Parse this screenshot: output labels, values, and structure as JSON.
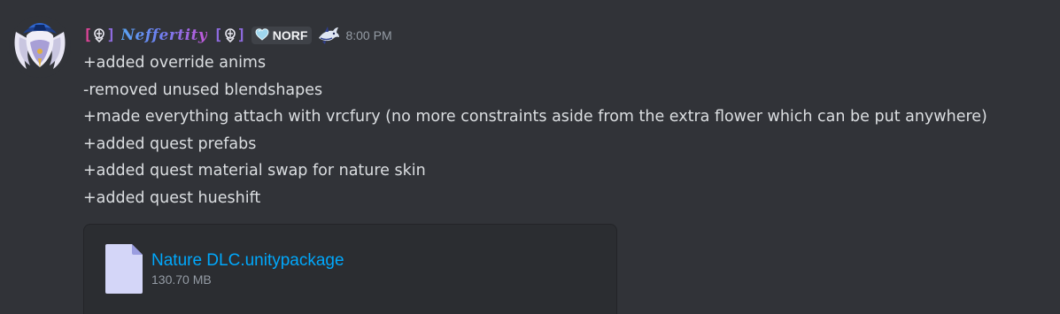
{
  "message": {
    "author": {
      "tag_left": {
        "open": "[",
        "icon": "role-emblem-icon",
        "close": "]"
      },
      "name": "Neffertity",
      "tag_right": {
        "open": "[",
        "icon": "role-emblem-icon",
        "close": "]"
      },
      "guild_tag": {
        "icon": "heart-icon",
        "text": "NORF"
      },
      "badge_icon": "shark-emoji-icon"
    },
    "timestamp": "8:00 PM",
    "lines": [
      "+added override anims",
      "-removed unused blendshapes",
      "+made everything attach with vrcfury (no more constraints aside from the extra flower which can be put anywhere)",
      "+added quest prefabs",
      "+added quest material swap for nature skin",
      "+added quest hueshift"
    ],
    "attachment": {
      "icon": "file-icon",
      "filename": "Nature DLC.unitypackage",
      "size": "130.70 MB"
    }
  },
  "colors": {
    "background": "#313338",
    "text": "#dbdee1",
    "link": "#00a8fc",
    "muted": "#949ba4",
    "attachment_bg": "#2b2d31",
    "file_icon": "#d4d6f8"
  }
}
